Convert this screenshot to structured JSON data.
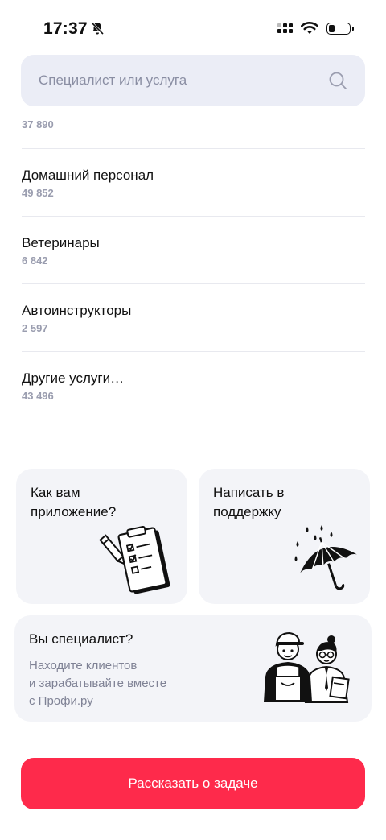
{
  "status_bar": {
    "time": "17:37"
  },
  "search": {
    "placeholder": "Специалист или услуга"
  },
  "partial_count": "37 890",
  "categories": [
    {
      "title": "Домашний персонал",
      "count": "49 852"
    },
    {
      "title": "Ветеринары",
      "count": "6 842"
    },
    {
      "title": "Автоинструкторы",
      "count": "2 597"
    },
    {
      "title": "Другие услуги…",
      "count": "43 496"
    }
  ],
  "cards": {
    "feedback": {
      "title_line1": "Как вам",
      "title_line2": "приложение?"
    },
    "support": {
      "title_line1": "Написать в",
      "title_line2": "поддержку"
    },
    "specialist": {
      "title": "Вы специалист?",
      "sub_line1": "Находите клиентов",
      "sub_line2": "и зарабатывайте вместе",
      "sub_line3": "с Профи.ру"
    }
  },
  "cta": {
    "label": "Рассказать о задаче"
  },
  "colors": {
    "accent": "#fe2a4b",
    "search_bg": "#ebedf6",
    "card_bg": "#f3f4f8",
    "muted_text": "#9a9daf"
  }
}
